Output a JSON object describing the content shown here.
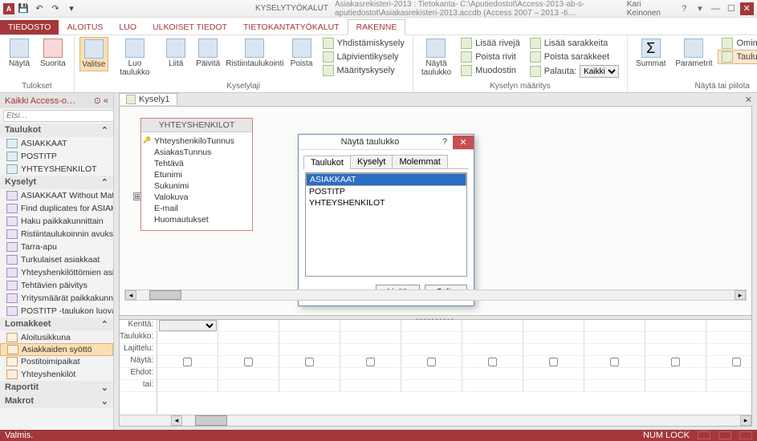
{
  "titlebar": {
    "app_letter": "A",
    "contextual_tool": "KYSELYTYÖKALUT",
    "title": "Asiakasrekisteri-2013 : Tietokanta- C:\\Aputiedostot\\Access-2013-ab-s-aputiedostot\\Asiakasrekisteri-2013.accdb (Access 2007 – 2013 -ti…",
    "user": "Kari Keinonen"
  },
  "ribbon_tabs": {
    "file": "TIEDOSTO",
    "home": "ALOITUS",
    "create": "LUO",
    "external": "ULKOISET TIEDOT",
    "dbtools": "TIETOKANTATYÖKALUT",
    "design": "RAKENNE"
  },
  "ribbon": {
    "results_group": "Tulokset",
    "view": "Näytä",
    "run": "Suorita",
    "select": "Valitse",
    "make_table": "Luo\ntaulukko",
    "append": "Liitä",
    "update": "Päivitä",
    "crosstab": "Ristiintaulukointi",
    "delete": "Poista",
    "union": "Yhdistämiskysely",
    "passthrough": "Läpivientikysely",
    "datadef": "Määrityskysely",
    "qtype_group": "Kyselylaji",
    "show_table": "Näytä\ntaulukko",
    "insert_rows": "Lisää rivejä",
    "delete_rows": "Poista rivit",
    "builder": "Muodostin",
    "insert_cols": "Lisää sarakkeita",
    "delete_cols": "Poista sarakkeet",
    "return_lbl": "Palauta:",
    "return_val": "Kaikki",
    "qsetup_group": "Kyselyn määritys",
    "totals": "Summat",
    "params": "Parametrit",
    "prop_sheet": "Ominaisuusikkuna",
    "table_names": "Taulukoiden nimet",
    "showhide_group": "Näytä tai piilota"
  },
  "navpane": {
    "header": "Kaikki Access-o…",
    "search_ph": "Etsi…",
    "cat_tables": "Taulukot",
    "tables": [
      "ASIAKKAAT",
      "POSTITP",
      "YHTEYSHENKILOT"
    ],
    "cat_queries": "Kyselyt",
    "queries": [
      "ASIAKKAAT Without Matchin…",
      "Find duplicates for ASIAKKAAT",
      "Haku paikkakunnittain",
      "Ristiintaulukoinnin avuksi",
      "Tarra-apu",
      "Turkulaiset asiakkaat",
      "Yhteyshenkilöttömien asiakk…",
      "Tehtävien päivitys",
      "Yritysmäärät paikkakunnittain",
      "POSTITP -taulukon luova kyse…"
    ],
    "cat_forms": "Lomakkeet",
    "forms": [
      "Aloitusikkuna",
      "Asiakkaiden syöttö",
      "Postitoimipaikat",
      "Yhteyshenkilöt"
    ],
    "cat_reports": "Raportit",
    "cat_macros": "Makrot"
  },
  "doc_tab": "Kysely1",
  "table_box": {
    "title": "YHTEYSHENKILOT",
    "fields": [
      "YhteyshenkiloTunnus",
      "AsiakasTunnus",
      "Tehtävä",
      "Etunimi",
      "Sukunimi",
      "Valokuva",
      "E-mail",
      "Huomautukset"
    ]
  },
  "dialog": {
    "title": "Näytä taulukko",
    "tab_tables": "Taulukot",
    "tab_queries": "Kyselyt",
    "tab_both": "Molemmat",
    "items": [
      "ASIAKKAAT",
      "POSTITP",
      "YHTEYSHENKILOT"
    ],
    "add": "Lisää",
    "close": "Sulje"
  },
  "qbe_labels": [
    "Kenttä:",
    "Taulukko:",
    "Lajittelu:",
    "Näytä:",
    "Ehdot:",
    "tai:"
  ],
  "status": {
    "ready": "Valmis.",
    "numlock": "NUM LOCK"
  }
}
